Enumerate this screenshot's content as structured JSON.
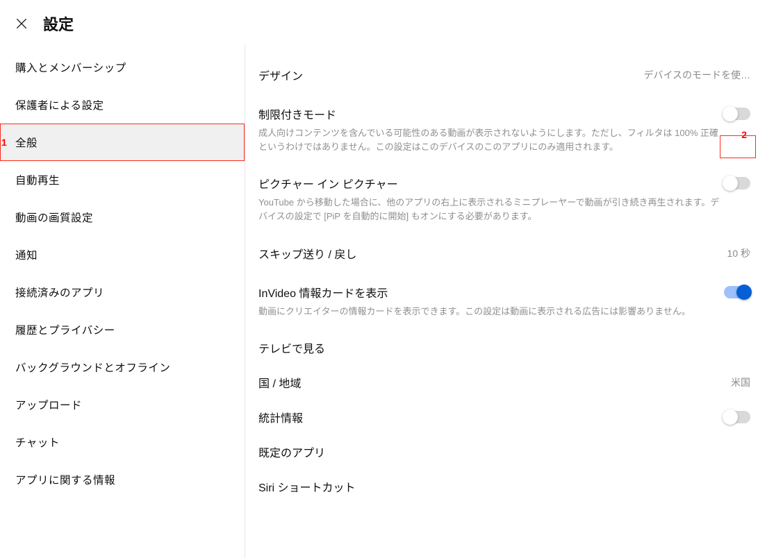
{
  "header": {
    "title": "設定"
  },
  "sidebar": {
    "items": [
      {
        "label": "購入とメンバーシップ",
        "selected": false
      },
      {
        "label": "保護者による設定",
        "selected": false
      },
      {
        "label": "全般",
        "selected": true
      },
      {
        "label": "自動再生",
        "selected": false
      },
      {
        "label": "動画の画質設定",
        "selected": false
      },
      {
        "label": "通知",
        "selected": false
      },
      {
        "label": "接続済みのアプリ",
        "selected": false
      },
      {
        "label": "履歴とプライバシー",
        "selected": false
      },
      {
        "label": "バックグラウンドとオフライン",
        "selected": false
      },
      {
        "label": "アップロード",
        "selected": false
      },
      {
        "label": "チャット",
        "selected": false
      },
      {
        "label": "アプリに関する情報",
        "selected": false
      }
    ]
  },
  "settings": {
    "design": {
      "title": "デザイン",
      "value": "デバイスのモードを使…"
    },
    "restricted": {
      "title": "制限付きモード",
      "desc": "成人向けコンテンツを含んでいる可能性のある動画が表示されないようにします。ただし、フィルタは 100% 正確というわけではありません。この設定はこのデバイスのこのアプリにのみ適用されます。",
      "on": false
    },
    "pip": {
      "title": "ピクチャー イン ピクチャー",
      "desc": "YouTube から移動した場合に、他のアプリの右上に表示されるミニプレーヤーで動画が引き続き再生されます。デバイスの設定で [PiP を自動的に開始] もオンにする必要があります。",
      "on": false
    },
    "skip": {
      "title": "スキップ送り / 戻し",
      "value": "10 秒"
    },
    "invideo": {
      "title": "InVideo 情報カードを表示",
      "desc": "動画にクリエイターの情報カードを表示できます。この設定は動画に表示される広告には影響ありません。",
      "on": true
    },
    "tv": {
      "title": "テレビで見る"
    },
    "country": {
      "title": "国 / 地域",
      "value": "米国"
    },
    "stats": {
      "title": "統計情報",
      "on": false
    },
    "defaultapp": {
      "title": "既定のアプリ"
    },
    "siri": {
      "title": "Siri ショートカット"
    }
  },
  "annotations": {
    "a1": "1",
    "a2": "2"
  }
}
